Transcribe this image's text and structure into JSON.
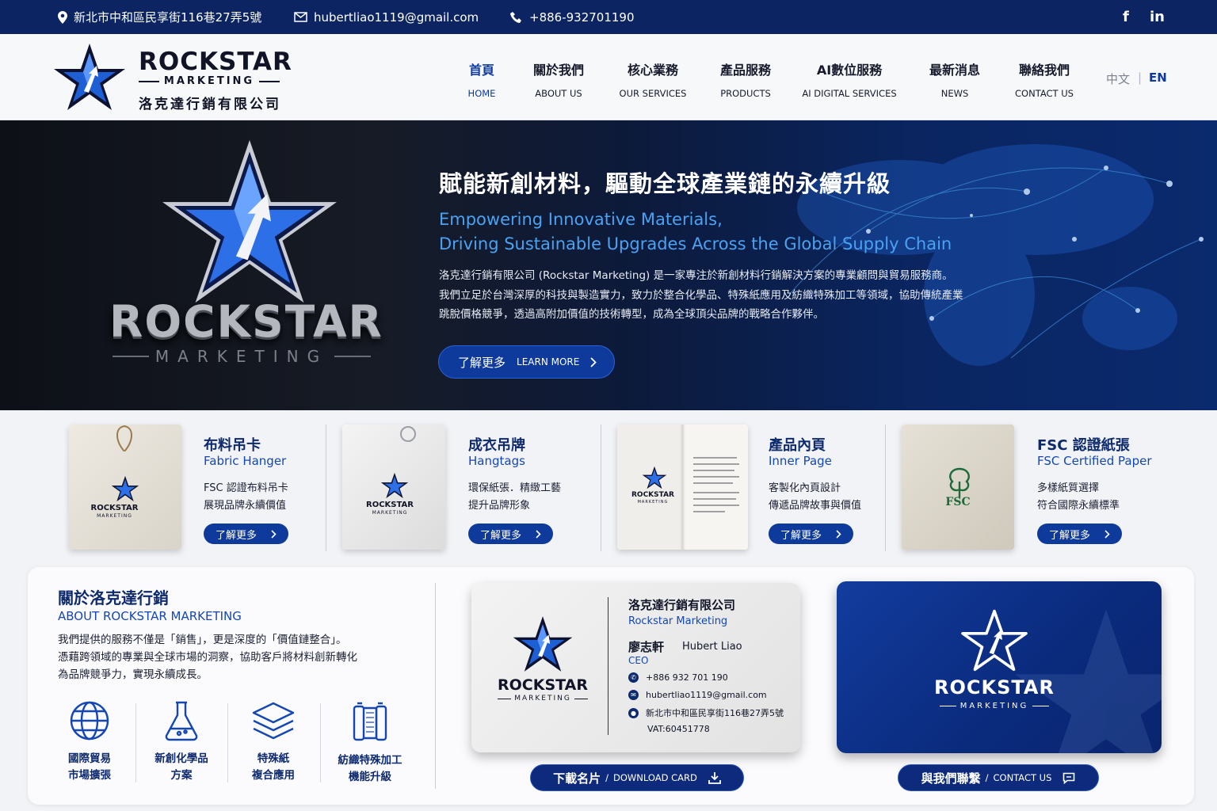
{
  "topbar": {
    "address": "新北市中和區民享街116巷27弄5號",
    "email": "hubertliao1119@gmail.com",
    "phone": "+886-932701190",
    "social": [
      "f",
      "in"
    ]
  },
  "header": {
    "brand": "ROCKSTAR",
    "brand_sub": "MARKETING",
    "brand_zh": "洛克達行銷有限公司",
    "nav": [
      {
        "zh": "首頁",
        "en": "HOME"
      },
      {
        "zh": "關於我們",
        "en": "ABOUT US"
      },
      {
        "zh": "核心業務",
        "en": "OUR SERVICES"
      },
      {
        "zh": "產品服務",
        "en": "PRODUCTS"
      },
      {
        "zh": "AI數位服務",
        "en": "AI DIGITAL SERVICES"
      },
      {
        "zh": "最新消息",
        "en": "NEWS"
      },
      {
        "zh": "聯絡我們",
        "en": "CONTACT US"
      }
    ],
    "lang_zh": "中文",
    "lang_sep": "|",
    "lang_en": "EN"
  },
  "hero": {
    "logo_text": "ROCKSTAR",
    "logo_sub": "MARKETING",
    "title": "賦能新創材料，驅動全球產業鏈的永續升級",
    "subtitle_line1": "Empowering Innovative Materials,",
    "subtitle_line2": "Driving Sustainable Upgrades Across the Global Supply Chain",
    "paragraph_line1": "洛克達行銷有限公司 (Rockstar Marketing) 是一家專注於新創材料行銷解決方案的專業顧問與貿易服務商。",
    "paragraph_line2": "我們立足於台灣深厚的科技與製造實力，致力於整合化學品、特殊紙應用及紡織特殊加工等領域，協助傳統產業",
    "paragraph_line3": "跳脫價格競爭，透過高附加價值的技術轉型，成為全球頂尖品牌的戰略合作夥伴。",
    "cta_zh": "了解更多",
    "cta_en": "LEARN MORE"
  },
  "products": [
    {
      "zh": "布料吊卡",
      "en": "Fabric Hanger",
      "d1": "FSC 認證布料吊卡",
      "d2": "展現品牌永續價值",
      "btn": "了解更多",
      "img_brand": "ROCKSTAR",
      "img_sub": "MARKETING"
    },
    {
      "zh": "成衣吊牌",
      "en": "Hangtags",
      "d1": "環保紙張．精緻工藝",
      "d2": "提升品牌形象",
      "btn": "了解更多",
      "img_brand": "ROCKSTAR",
      "img_sub": "MARKETING"
    },
    {
      "zh": "產品內頁",
      "en": "Inner Page",
      "d1": "客製化內頁設計",
      "d2": "傳遞品牌故事與價值",
      "btn": "了解更多",
      "img_brand": "ROCKSTAR",
      "img_sub": "MARKETING"
    },
    {
      "zh": "FSC 認證紙張",
      "en": "FSC Certified Paper",
      "d1": "多樣紙質選擇",
      "d2": "符合國際永續標準",
      "btn": "了解更多",
      "img_brand": "FSC"
    }
  ],
  "about": {
    "title_zh": "關於洛克達行銷",
    "title_en": "ABOUT ROCKSTAR MARKETING",
    "p1": "我們提供的服務不僅是「銷售」，更是深度的「價值鏈整合」。",
    "p2": "憑藉跨領域的專業與全球市場的洞察，協助客戶將材料創新轉化",
    "p3": "為品牌競爭力，實現永續成長。",
    "services": [
      {
        "l1": "國際貿易",
        "l2": "市場擴張",
        "icon": "globe-icon"
      },
      {
        "l1": "新創化學品",
        "l2": "方案",
        "icon": "flask-icon"
      },
      {
        "l1": "特殊紙",
        "l2": "複合應用",
        "icon": "layers-icon"
      },
      {
        "l1": "紡織特殊加工",
        "l2": "機能升級",
        "icon": "textile-icon"
      }
    ]
  },
  "business_card": {
    "brand": "ROCKSTAR",
    "brand_sub": "MARKETING",
    "company_zh": "洛克達行銷有限公司",
    "company_en": "Rockstar Marketing",
    "name_zh": "廖志軒",
    "name_en": "Hubert Liao",
    "title": "CEO",
    "phone": "+886 932 701 190",
    "email": "hubertliao1119@gmail.com",
    "address": "新北市中和區民享街116巷27弄5號",
    "vat": "VAT:60451778",
    "download_zh": "下載名片",
    "download_sep": "/",
    "download_en": "DOWNLOAD CARD"
  },
  "card_back": {
    "brand": "ROCKSTAR",
    "brand_sub": "MARKETING",
    "contact_zh": "與我們聯繫",
    "contact_sep": "/",
    "contact_en": "CONTACT US"
  },
  "colors": {
    "primary": "#0e3a9c",
    "navy": "#0c2461",
    "accent": "#4aa2f2"
  }
}
